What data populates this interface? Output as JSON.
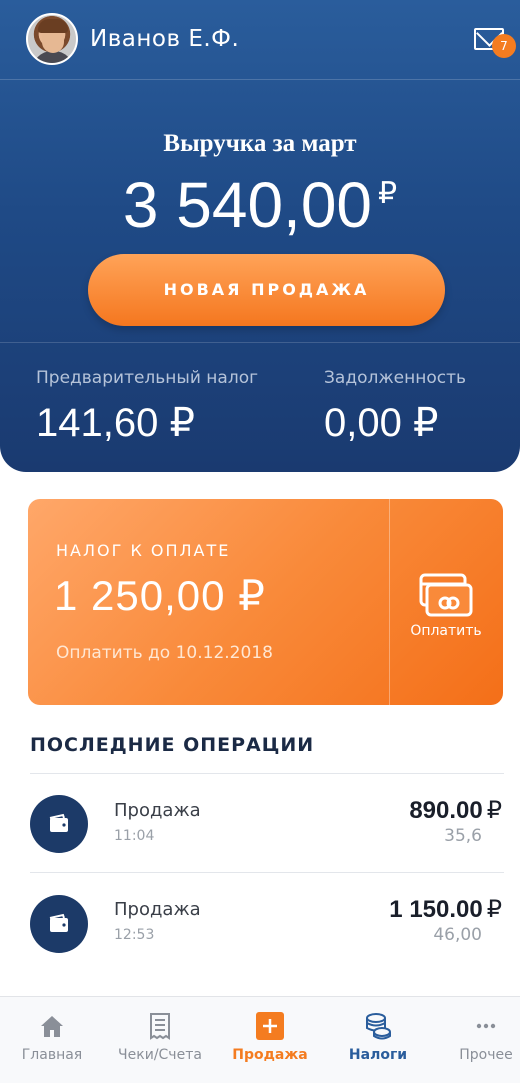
{
  "user": {
    "name": "Иванов Е.Ф.",
    "unread_count": "7"
  },
  "revenue": {
    "title": "Выручка за март",
    "amount": "3 540,00",
    "currency": "₽"
  },
  "new_sale_label": "НОВАЯ ПРОДАЖА",
  "stats": {
    "prelim_tax_label": "Предварительный налог",
    "prelim_tax_value": "141,60 ₽",
    "debt_label": "Задолженность",
    "debt_value": "0,00 ₽"
  },
  "tax_card": {
    "title": "НАЛОГ К ОПЛАТЕ",
    "amount": "1 250,00 ₽",
    "due": "Оплатить до 10.12.2018",
    "pay_label": "Оплатить"
  },
  "operations": {
    "title": "ПОСЛЕДНИЕ ОПЕРАЦИИ",
    "items": [
      {
        "name": "Продажа",
        "time": "11:04",
        "amount": "890.00",
        "currency": "₽",
        "tax": "35,6"
      },
      {
        "name": "Продажа",
        "time": "12:53",
        "amount": "1 150.00",
        "currency": "₽",
        "tax": "46,00"
      }
    ]
  },
  "tabs": [
    {
      "label": "Главная",
      "icon": "home-icon"
    },
    {
      "label": "Чеки/Счета",
      "icon": "receipt-icon"
    },
    {
      "label": "Продажа",
      "icon": "plus-icon"
    },
    {
      "label": "Налоги",
      "icon": "coins-icon"
    },
    {
      "label": "Прочее",
      "icon": "more-icon"
    }
  ],
  "colors": {
    "primary": "#1f4a86",
    "accent": "#f47c20",
    "tab_taxes": "#2a5d9c"
  }
}
